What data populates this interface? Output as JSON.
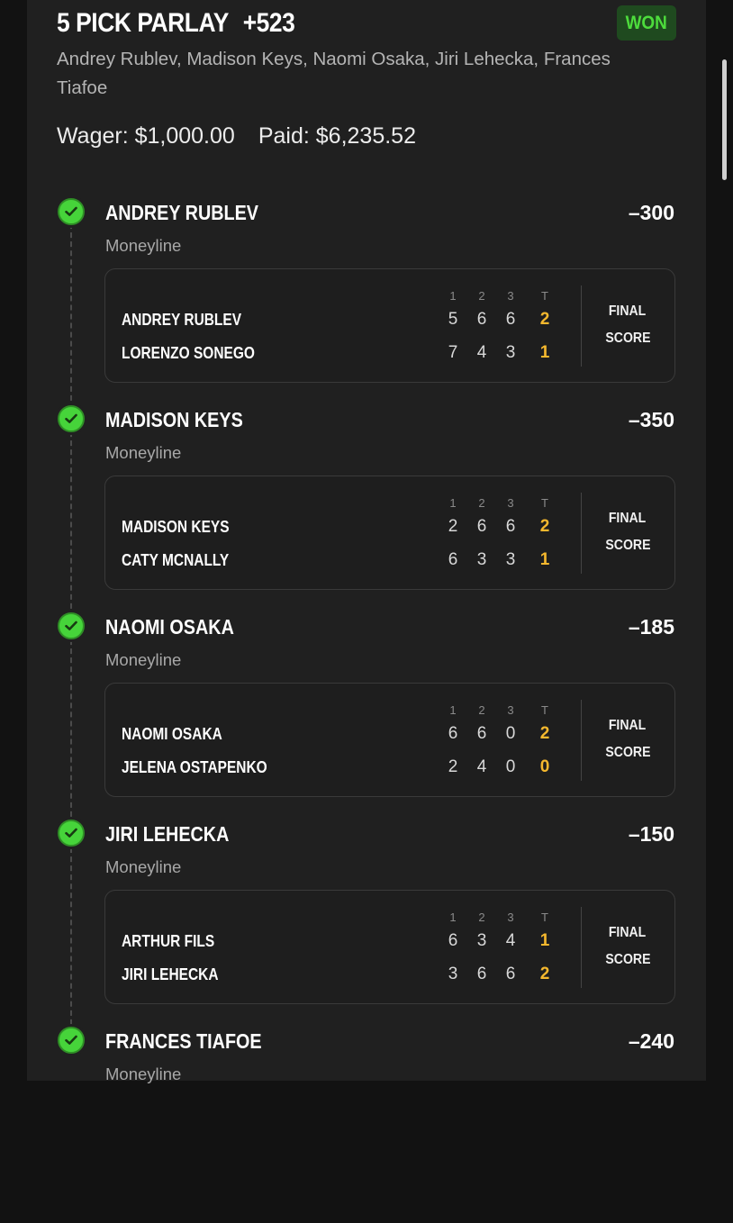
{
  "bet": {
    "title": "5 PICK PARLAY",
    "odds": "+523",
    "status": "WON",
    "players": "Andrey Rublev, Madison Keys, Naomi Osaka, Jiri Lehecka, Frances Tiafoe",
    "wager": "Wager: $1,000.00",
    "paid": "Paid: $6,235.52"
  },
  "set_headers": [
    "1",
    "2",
    "3",
    "T"
  ],
  "final_label": [
    "FINAL",
    "SCORE"
  ],
  "legs": [
    {
      "pick": "ANDREY RUBLEV",
      "odds": "–300",
      "market": "Moneyline",
      "rows": [
        {
          "name": "ANDREY RUBLEV",
          "s1": "5",
          "s2": "6",
          "s3": "6",
          "t": "2"
        },
        {
          "name": "LORENZO SONEGO",
          "s1": "7",
          "s2": "4",
          "s3": "3",
          "t": "1"
        }
      ]
    },
    {
      "pick": "MADISON KEYS",
      "odds": "–350",
      "market": "Moneyline",
      "rows": [
        {
          "name": "MADISON KEYS",
          "s1": "2",
          "s2": "6",
          "s3": "6",
          "t": "2"
        },
        {
          "name": "CATY MCNALLY",
          "s1": "6",
          "s2": "3",
          "s3": "3",
          "t": "1"
        }
      ]
    },
    {
      "pick": "NAOMI OSAKA",
      "odds": "–185",
      "market": "Moneyline",
      "rows": [
        {
          "name": "NAOMI OSAKA",
          "s1": "6",
          "s2": "6",
          "s3": "0",
          "t": "2"
        },
        {
          "name": "JELENA OSTAPENKO",
          "s1": "2",
          "s2": "4",
          "s3": "0",
          "t": "0"
        }
      ]
    },
    {
      "pick": "JIRI LEHECKA",
      "odds": "–150",
      "market": "Moneyline",
      "rows": [
        {
          "name": "ARTHUR FILS",
          "s1": "6",
          "s2": "3",
          "s3": "4",
          "t": "1"
        },
        {
          "name": "JIRI LEHECKA",
          "s1": "3",
          "s2": "6",
          "s3": "6",
          "t": "2"
        }
      ]
    },
    {
      "pick": "FRANCES TIAFOE",
      "odds": "–240",
      "market": "Moneyline"
    }
  ],
  "colors": {
    "background": "#202020",
    "win_green": "#46d43a",
    "total_gold": "#f5b82e"
  },
  "icons": {
    "leg_status": "check-circle-icon"
  }
}
